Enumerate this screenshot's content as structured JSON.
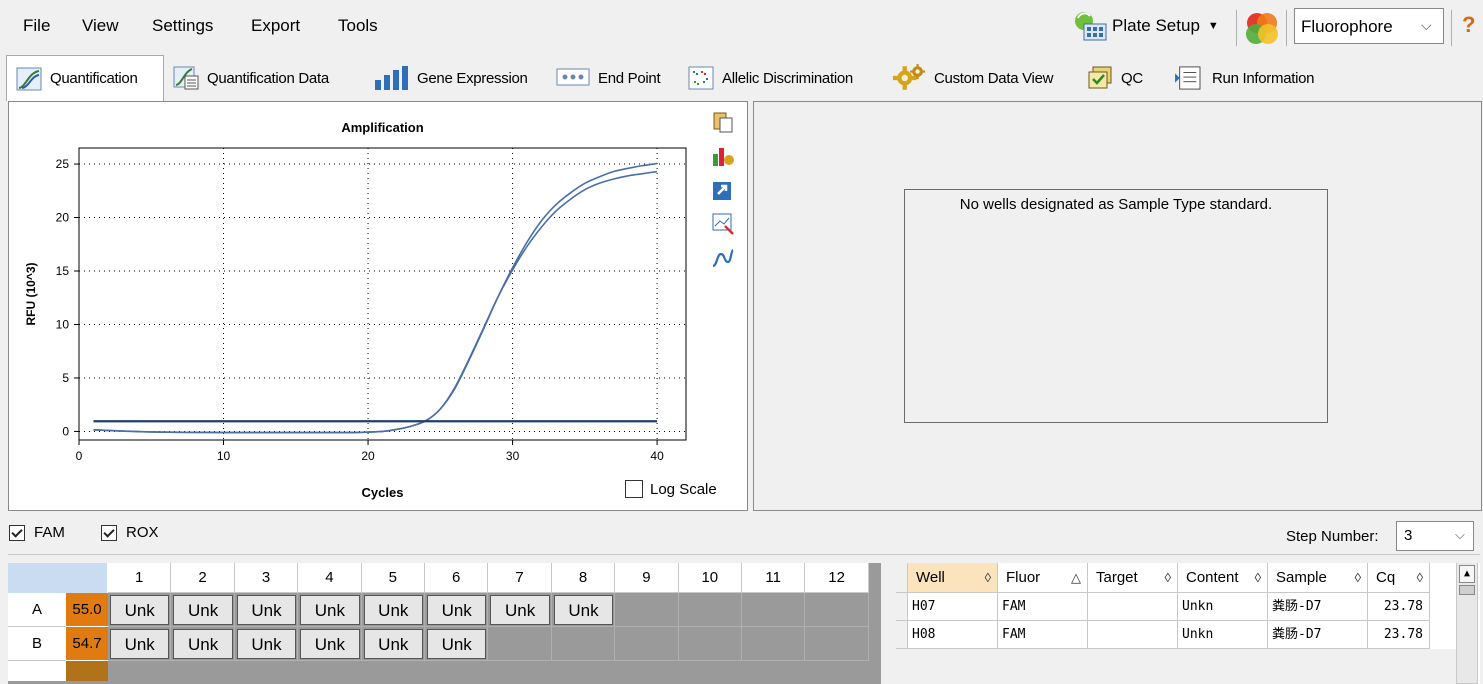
{
  "menu": {
    "items": [
      {
        "label": "File"
      },
      {
        "label": "View"
      },
      {
        "label": "Settings"
      },
      {
        "label": "Export"
      },
      {
        "label": "Tools"
      }
    ],
    "plate_setup_label": "Plate Setup",
    "fluorophore_select": "Fluorophore",
    "help_label": "?"
  },
  "tabs": [
    {
      "label": "Quantification",
      "active": true,
      "icon": "amplification-curves-icon"
    },
    {
      "label": "Quantification Data",
      "active": false,
      "icon": "quantification-data-icon"
    },
    {
      "label": "Gene Expression",
      "active": false,
      "icon": "bar-chart-icon"
    },
    {
      "label": "End Point",
      "active": false,
      "icon": "end-point-icon"
    },
    {
      "label": "Allelic Discrimination",
      "active": false,
      "icon": "allelic-scatter-icon"
    },
    {
      "label": "Custom Data View",
      "active": false,
      "icon": "gear-icon"
    },
    {
      "label": "QC",
      "active": false,
      "icon": "qc-check-icon"
    },
    {
      "label": "Run Information",
      "active": false,
      "icon": "run-information-icon"
    }
  ],
  "chart_data": {
    "type": "line",
    "title": "Amplification",
    "xlabel": "Cycles",
    "ylabel": "RFU (10^3)",
    "xlim": [
      0,
      42
    ],
    "ylim": [
      -0.8,
      26.5
    ],
    "xticks": [
      0,
      10,
      20,
      30,
      40
    ],
    "yticks": [
      0,
      5,
      10,
      15,
      20,
      25
    ],
    "grid": "dotted",
    "series": [
      {
        "color": "#4a6fa5",
        "x": [
          1,
          5,
          10,
          15,
          19,
          21,
          22,
          23,
          24,
          25,
          26,
          27,
          28,
          29,
          30,
          31,
          32,
          33,
          34,
          35,
          36,
          37,
          38,
          39,
          40
        ],
        "y": [
          0.15,
          -0.05,
          -0.1,
          -0.1,
          -0.1,
          0.0,
          0.2,
          0.5,
          1.0,
          2.1,
          4.0,
          6.7,
          9.6,
          12.6,
          15.3,
          17.7,
          19.7,
          21.2,
          22.3,
          23.2,
          23.8,
          24.3,
          24.6,
          24.85,
          25.05
        ]
      },
      {
        "color": "#4a6fa5",
        "x": [
          1,
          5,
          10,
          15,
          19,
          21,
          22,
          23,
          24,
          25,
          26,
          27,
          28,
          29,
          30,
          31,
          32,
          33,
          34,
          35,
          36,
          37,
          38,
          39,
          40
        ],
        "y": [
          0.15,
          -0.05,
          -0.1,
          -0.1,
          -0.1,
          0.0,
          0.2,
          0.5,
          1.0,
          2.1,
          4.1,
          6.8,
          9.7,
          12.6,
          15.1,
          17.3,
          19.1,
          20.6,
          21.7,
          22.6,
          23.2,
          23.6,
          23.9,
          24.1,
          24.3
        ]
      },
      {
        "color": "#1f3f6f",
        "name": "threshold",
        "x": [
          1,
          40
        ],
        "y": [
          0.95,
          0.95
        ]
      }
    ]
  },
  "chart_tools": {
    "log_scale_label": "Log Scale",
    "log_scale_checked": false
  },
  "right_panel": {
    "message": "No wells designated as Sample Type standard."
  },
  "fluor_filters": [
    {
      "label": "FAM",
      "checked": true
    },
    {
      "label": "ROX",
      "checked": true
    }
  ],
  "step_number": {
    "label": "Step Number:",
    "value": "3"
  },
  "plate": {
    "columns": [
      "1",
      "2",
      "3",
      "4",
      "5",
      "6",
      "7",
      "8",
      "9",
      "10",
      "11",
      "12"
    ],
    "rows": [
      {
        "label": "A",
        "value": "55.0",
        "cells": [
          "Unk",
          "Unk",
          "Unk",
          "Unk",
          "Unk",
          "Unk",
          "Unk",
          "Unk",
          "",
          "",
          "",
          ""
        ]
      },
      {
        "label": "B",
        "value": "54.7",
        "cells": [
          "Unk",
          "Unk",
          "Unk",
          "Unk",
          "Unk",
          "Unk",
          "",
          "",
          "",
          "",
          "",
          ""
        ]
      }
    ]
  },
  "well_table": {
    "headers": [
      "Well",
      "Fluor",
      "Target",
      "Content",
      "Sample",
      "Cq"
    ],
    "rows": [
      [
        "H07",
        "FAM",
        "",
        "Unkn",
        "粪肠-D7",
        "23.78"
      ],
      [
        "H08",
        "FAM",
        "",
        "Unkn",
        "粪肠-D7",
        "23.78"
      ]
    ]
  }
}
